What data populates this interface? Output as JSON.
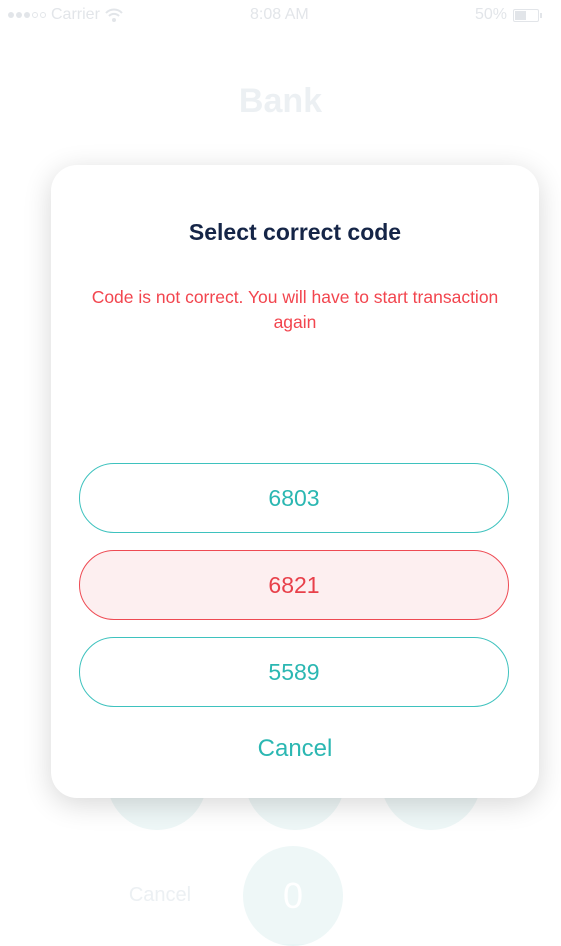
{
  "status_bar": {
    "carrier": "Carrier",
    "time": "8:08 AM",
    "battery": "50%",
    "battery_level": 0.5,
    "icons": [
      "signal-dots-icon",
      "wifi-icon",
      "battery-icon"
    ]
  },
  "app": {
    "title": "Bank",
    "keypad_visible": [
      "",
      "",
      "",
      "0"
    ],
    "cancel_label": "Cancel"
  },
  "modal": {
    "title": "Select correct code",
    "error_message": "Code is not correct. You will have to start transaction again",
    "options": [
      {
        "code": "6803",
        "state": "default"
      },
      {
        "code": "6821",
        "state": "wrong"
      },
      {
        "code": "5589",
        "state": "default"
      }
    ],
    "cancel_label": "Cancel"
  },
  "colors": {
    "accent_teal": "#2bb7b2",
    "error_red": "#f2454e",
    "title_navy": "#152547",
    "wrong_fill": "#fdeff0"
  }
}
